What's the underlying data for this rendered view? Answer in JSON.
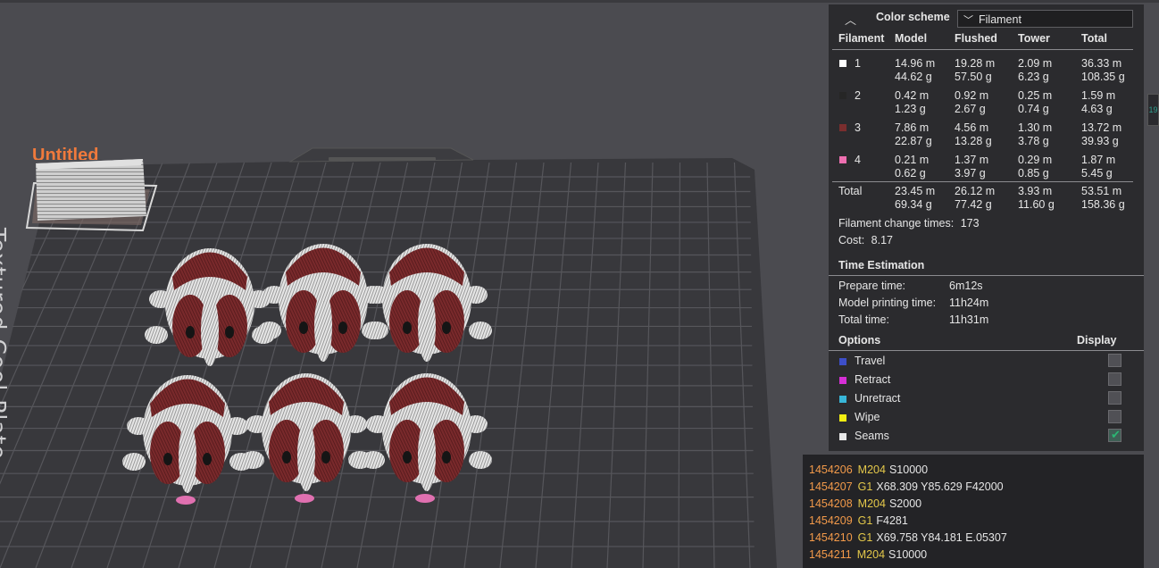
{
  "plate": {
    "label": "Textured Cool Plate",
    "object_name": "Untitled"
  },
  "panel": {
    "color_scheme_label": "Color scheme",
    "color_scheme_value": "Filament",
    "headers": [
      "Filament",
      "Model",
      "Flushed",
      "Tower",
      "Total"
    ],
    "filaments": [
      {
        "id": "1",
        "color": "#ffffff",
        "model": [
          "14.96 m",
          "44.62 g"
        ],
        "flushed": [
          "19.28 m",
          "57.50 g"
        ],
        "tower": [
          "2.09 m",
          "6.23 g"
        ],
        "total": [
          "36.33 m",
          "108.35 g"
        ]
      },
      {
        "id": "2",
        "color": "#262626",
        "model": [
          "0.42 m",
          "1.23 g"
        ],
        "flushed": [
          "0.92 m",
          "2.67 g"
        ],
        "tower": [
          "0.25 m",
          "0.74 g"
        ],
        "total": [
          "1.59 m",
          "4.63 g"
        ]
      },
      {
        "id": "3",
        "color": "#7a2e2e",
        "model": [
          "7.86 m",
          "22.87 g"
        ],
        "flushed": [
          "4.56 m",
          "13.28 g"
        ],
        "tower": [
          "1.30 m",
          "3.78 g"
        ],
        "total": [
          "13.72 m",
          "39.93 g"
        ]
      },
      {
        "id": "4",
        "color": "#ee6fb0",
        "model": [
          "0.21 m",
          "0.62 g"
        ],
        "flushed": [
          "1.37 m",
          "3.97 g"
        ],
        "tower": [
          "0.29 m",
          "0.85 g"
        ],
        "total": [
          "1.87 m",
          "5.45 g"
        ]
      }
    ],
    "total_row": {
      "label": "Total",
      "model": [
        "23.45 m",
        "69.34 g"
      ],
      "flushed": [
        "26.12 m",
        "77.42 g"
      ],
      "tower": [
        "3.93 m",
        "11.60 g"
      ],
      "total": [
        "53.51 m",
        "158.36 g"
      ]
    },
    "filament_change_label": "Filament change times:",
    "filament_change_value": "173",
    "cost_label": "Cost:",
    "cost_value": "8.17",
    "time_title": "Time Estimation",
    "prepare_label": "Prepare time:",
    "prepare_value": "6m12s",
    "model_time_label": "Model printing time:",
    "model_time_value": "11h24m",
    "total_time_label": "Total time:",
    "total_time_value": "11h31m",
    "options_title": "Options",
    "display_title": "Display",
    "options": [
      {
        "label": "Travel",
        "color": "#3d4fc9",
        "checked": false
      },
      {
        "label": "Retract",
        "color": "#d62fd6",
        "checked": false
      },
      {
        "label": "Unretract",
        "color": "#38b6d8",
        "checked": false
      },
      {
        "label": "Wipe",
        "color": "#f2ee12",
        "checked": false
      },
      {
        "label": "Seams",
        "color": "#e8e8e8",
        "checked": true
      }
    ]
  },
  "gcode": [
    {
      "line": "1454206",
      "cmd": "M204",
      "args": "S10000"
    },
    {
      "line": "1454207",
      "cmd": "G1",
      "args": "X68.309 Y85.629 F42000"
    },
    {
      "line": "1454208",
      "cmd": "M204",
      "args": "S2000"
    },
    {
      "line": "1454209",
      "cmd": "G1",
      "args": "F4281"
    },
    {
      "line": "1454210",
      "cmd": "G1",
      "args": "X69.758 Y84.181 E.05307"
    },
    {
      "line": "1454211",
      "cmd": "M204",
      "args": "S10000"
    }
  ],
  "side_tab_text": "19",
  "colors": {
    "background": "#4b4b50",
    "panel": "#2b2b2e",
    "plate": "#38383c",
    "grid": "#5a5a5f",
    "accent_orange": "#f07a3c"
  }
}
